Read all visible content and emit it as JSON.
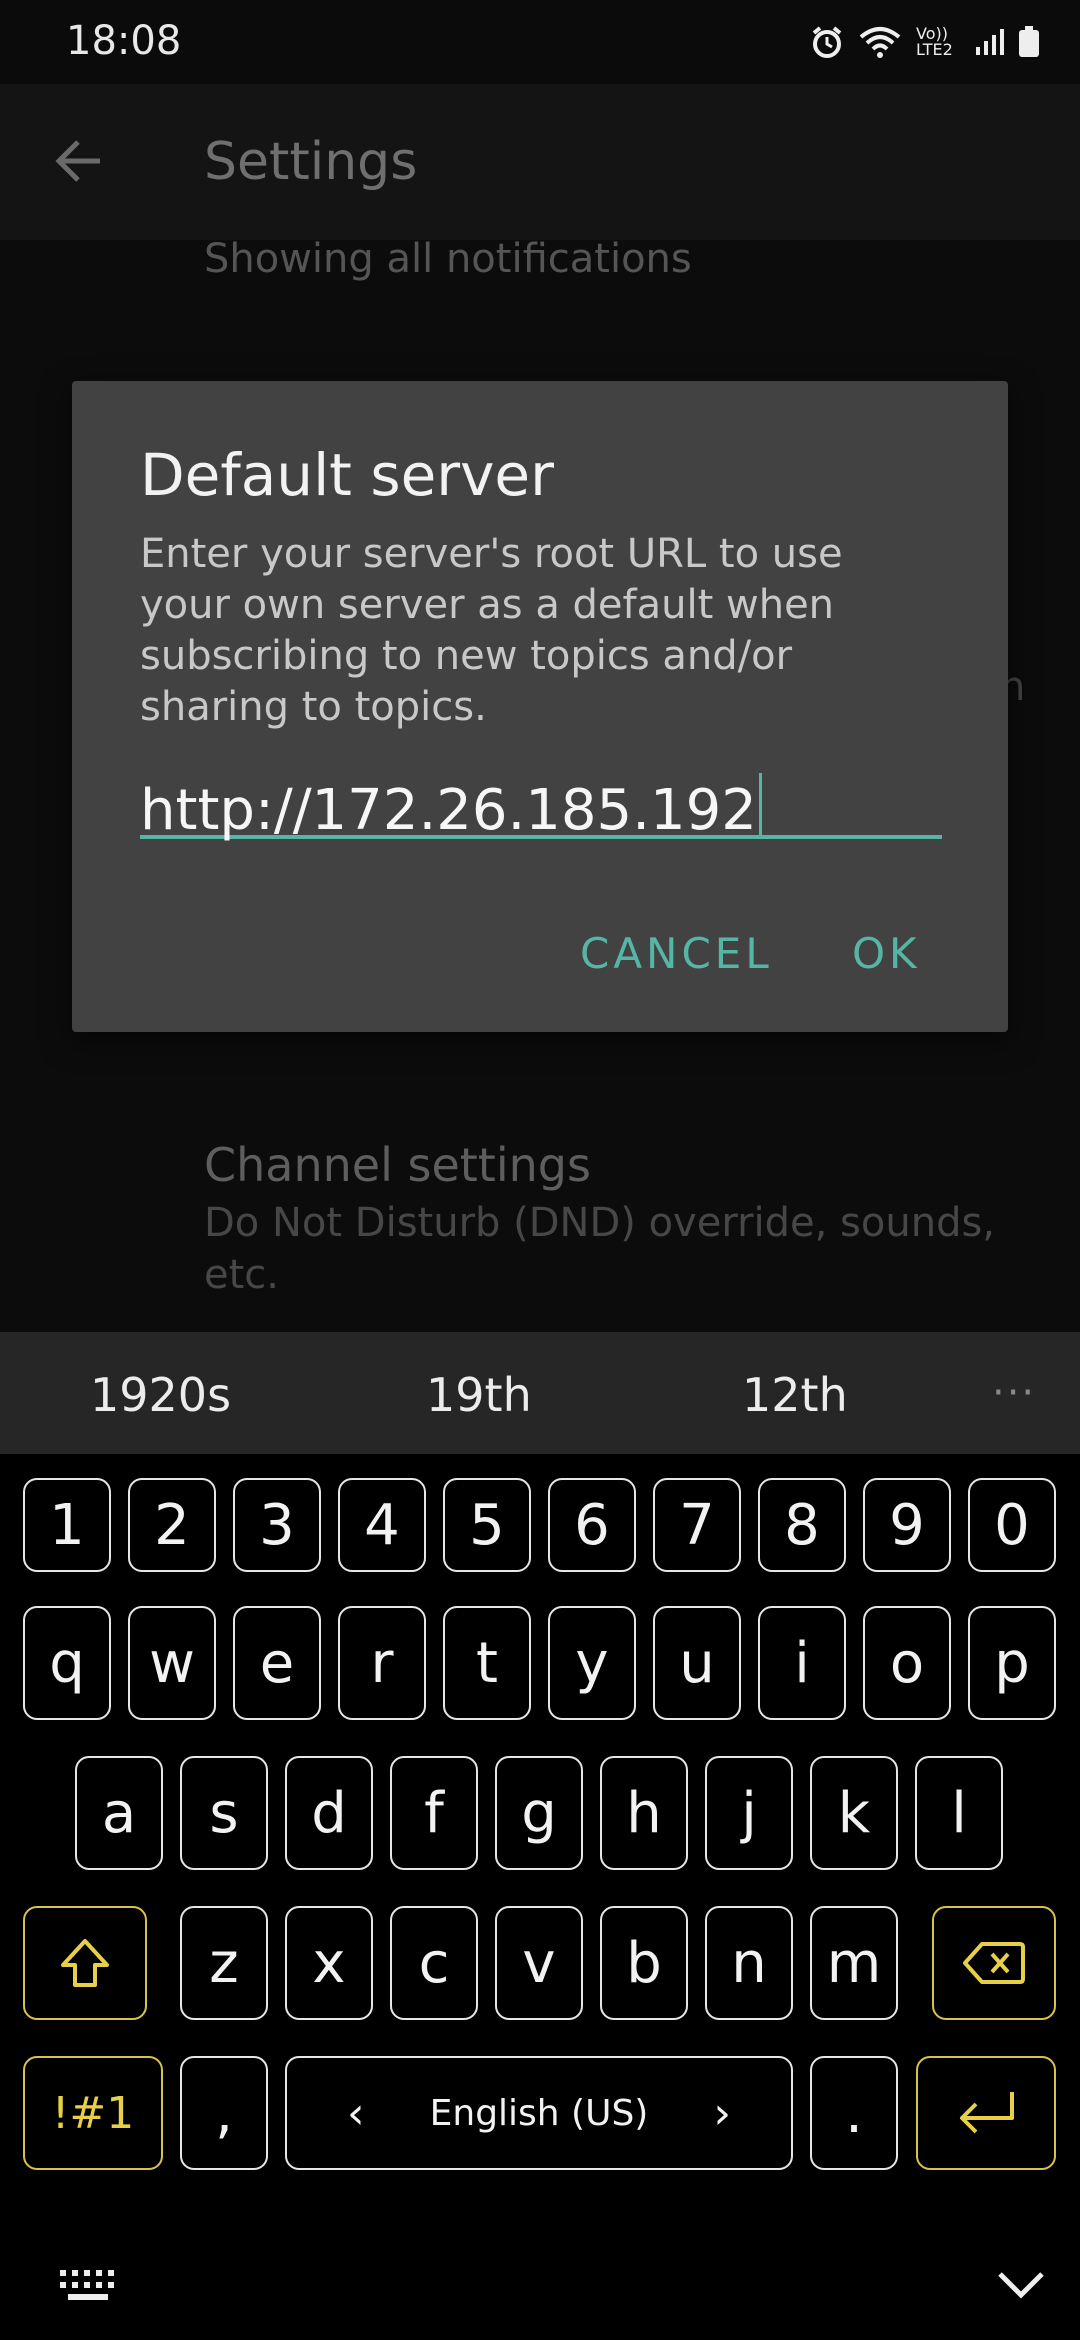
{
  "status_bar": {
    "time": "18:08",
    "network_label": "Vo)) LTE2",
    "icons": [
      "alarm-icon",
      "wifi-icon",
      "volte-icon",
      "signal-icon",
      "battery-icon"
    ]
  },
  "toolbar": {
    "title": "Settings"
  },
  "background": {
    "notifications_subtitle": "Showing all notifications",
    "trailing_fragment": "h",
    "channel_title": "Channel settings",
    "channel_subtitle_line1": "Do Not Disturb (DND) override, sounds,",
    "channel_subtitle_line2": "etc."
  },
  "dialog": {
    "title": "Default server",
    "message": "Enter your server's root URL to use your own server as a default when subscribing to new topics and/or sharing to topics.",
    "input_value": "http://172.26.185.192",
    "cancel_label": "CANCEL",
    "ok_label": "OK"
  },
  "suggestions": [
    "1920s",
    "19th",
    "12th"
  ],
  "suggestion_more": "···",
  "keyboard": {
    "number_row": [
      "1",
      "2",
      "3",
      "4",
      "5",
      "6",
      "7",
      "8",
      "9",
      "0"
    ],
    "row1": [
      "q",
      "w",
      "e",
      "r",
      "t",
      "y",
      "u",
      "i",
      "o",
      "p"
    ],
    "row2": [
      "a",
      "s",
      "d",
      "f",
      "g",
      "h",
      "j",
      "k",
      "l"
    ],
    "row3": [
      "z",
      "x",
      "c",
      "v",
      "b",
      "n",
      "m"
    ],
    "symbols_label": "!#1",
    "comma": ",",
    "space_label": "English (US)",
    "space_left_arrow": "‹",
    "space_right_arrow": "›",
    "period": ".",
    "accent_color": "#e7cf47"
  },
  "colors": {
    "accent": "#56b6a6",
    "dialog_bg": "#424242"
  }
}
